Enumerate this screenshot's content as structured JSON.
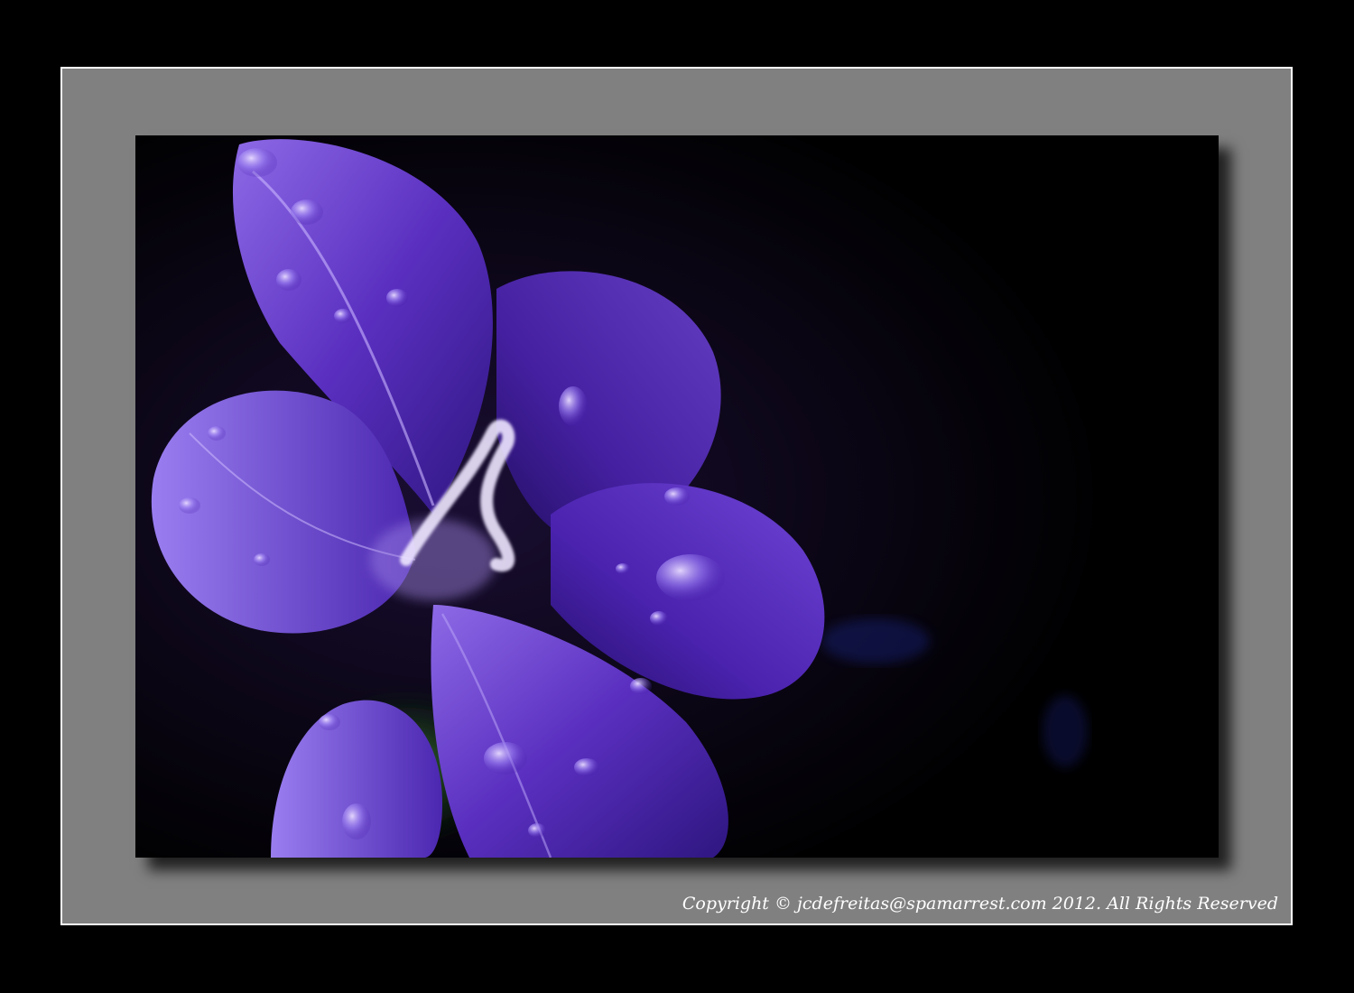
{
  "colors": {
    "background": "#000000",
    "mat": "#808080",
    "mat_border": "#ffffff",
    "petal_dark": "#3a1a8c",
    "petal_mid": "#6a3fd0",
    "petal_light": "#b59cf0",
    "stem_green": "#2e6b2a",
    "text": "#ffffff"
  },
  "photo": {
    "subject": "purple-flower-icon"
  },
  "watermark": {
    "copyright_text": "Copyright © jcdefreitas@spamarrest.com 2012. All Rights Reserved"
  }
}
